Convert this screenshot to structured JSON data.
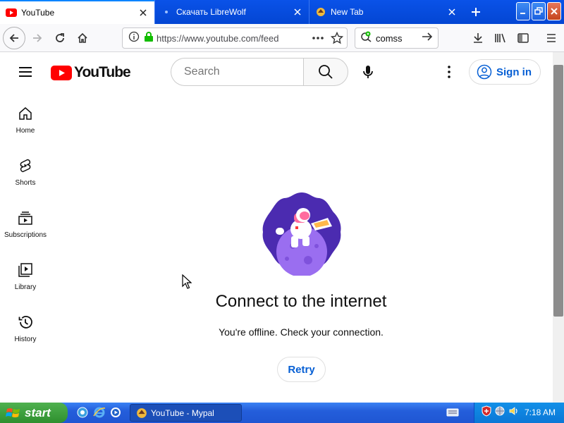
{
  "browser": {
    "tabs": [
      {
        "title": "YouTube",
        "active": true
      },
      {
        "title": "Скачать LibreWolf",
        "active": false
      },
      {
        "title": "New Tab",
        "active": false
      }
    ],
    "url": "https://www.youtube.com/feed",
    "search_query": "comss"
  },
  "youtube": {
    "logo_text": "YouTube",
    "search_placeholder": "Search",
    "sign_in_label": "Sign in",
    "sidebar": [
      {
        "label": "Home",
        "icon": "home-icon"
      },
      {
        "label": "Shorts",
        "icon": "shorts-icon"
      },
      {
        "label": "Subscriptions",
        "icon": "subscriptions-icon"
      },
      {
        "label": "Library",
        "icon": "library-icon"
      },
      {
        "label": "History",
        "icon": "history-icon"
      }
    ],
    "offline": {
      "title": "Connect to the internet",
      "message": "You're offline. Check your connection.",
      "retry_label": "Retry"
    }
  },
  "taskbar": {
    "start_label": "start",
    "task_label": "YouTube - Mypal",
    "clock": "7:18 AM"
  },
  "colors": {
    "yt_red": "#ff0000",
    "link_blue": "#065fd4",
    "xp_blue": "#245edb",
    "start_green": "#3c9a3c"
  }
}
